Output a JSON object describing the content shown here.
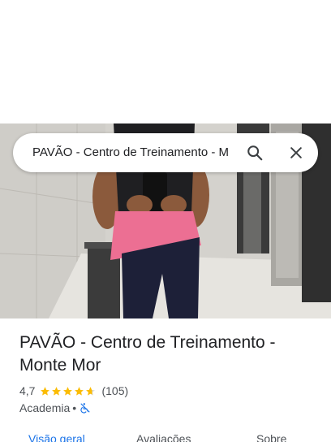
{
  "search": {
    "query": "PAVÃO - Centro de Treinamento - M",
    "search_icon": "search-icon",
    "close_icon": "close-icon"
  },
  "place": {
    "title": "PAVÃO - Centro de Treinamento - Monte Mor",
    "rating": "4,7",
    "stars": 4.7,
    "review_count": "(105)",
    "category": "Academia",
    "separator": "•",
    "accessibility_icon": "not-wheelchair-accessible-icon"
  },
  "tabs": [
    {
      "label": "Visão geral",
      "selected": true
    },
    {
      "label": "Avaliações",
      "selected": false
    },
    {
      "label": "Sobre",
      "selected": false
    }
  ],
  "colors": {
    "star": "#fbbc04",
    "accent": "#1a73e8",
    "secondary_text": "#4d5156",
    "shirt_pink": "#ec6f93"
  }
}
